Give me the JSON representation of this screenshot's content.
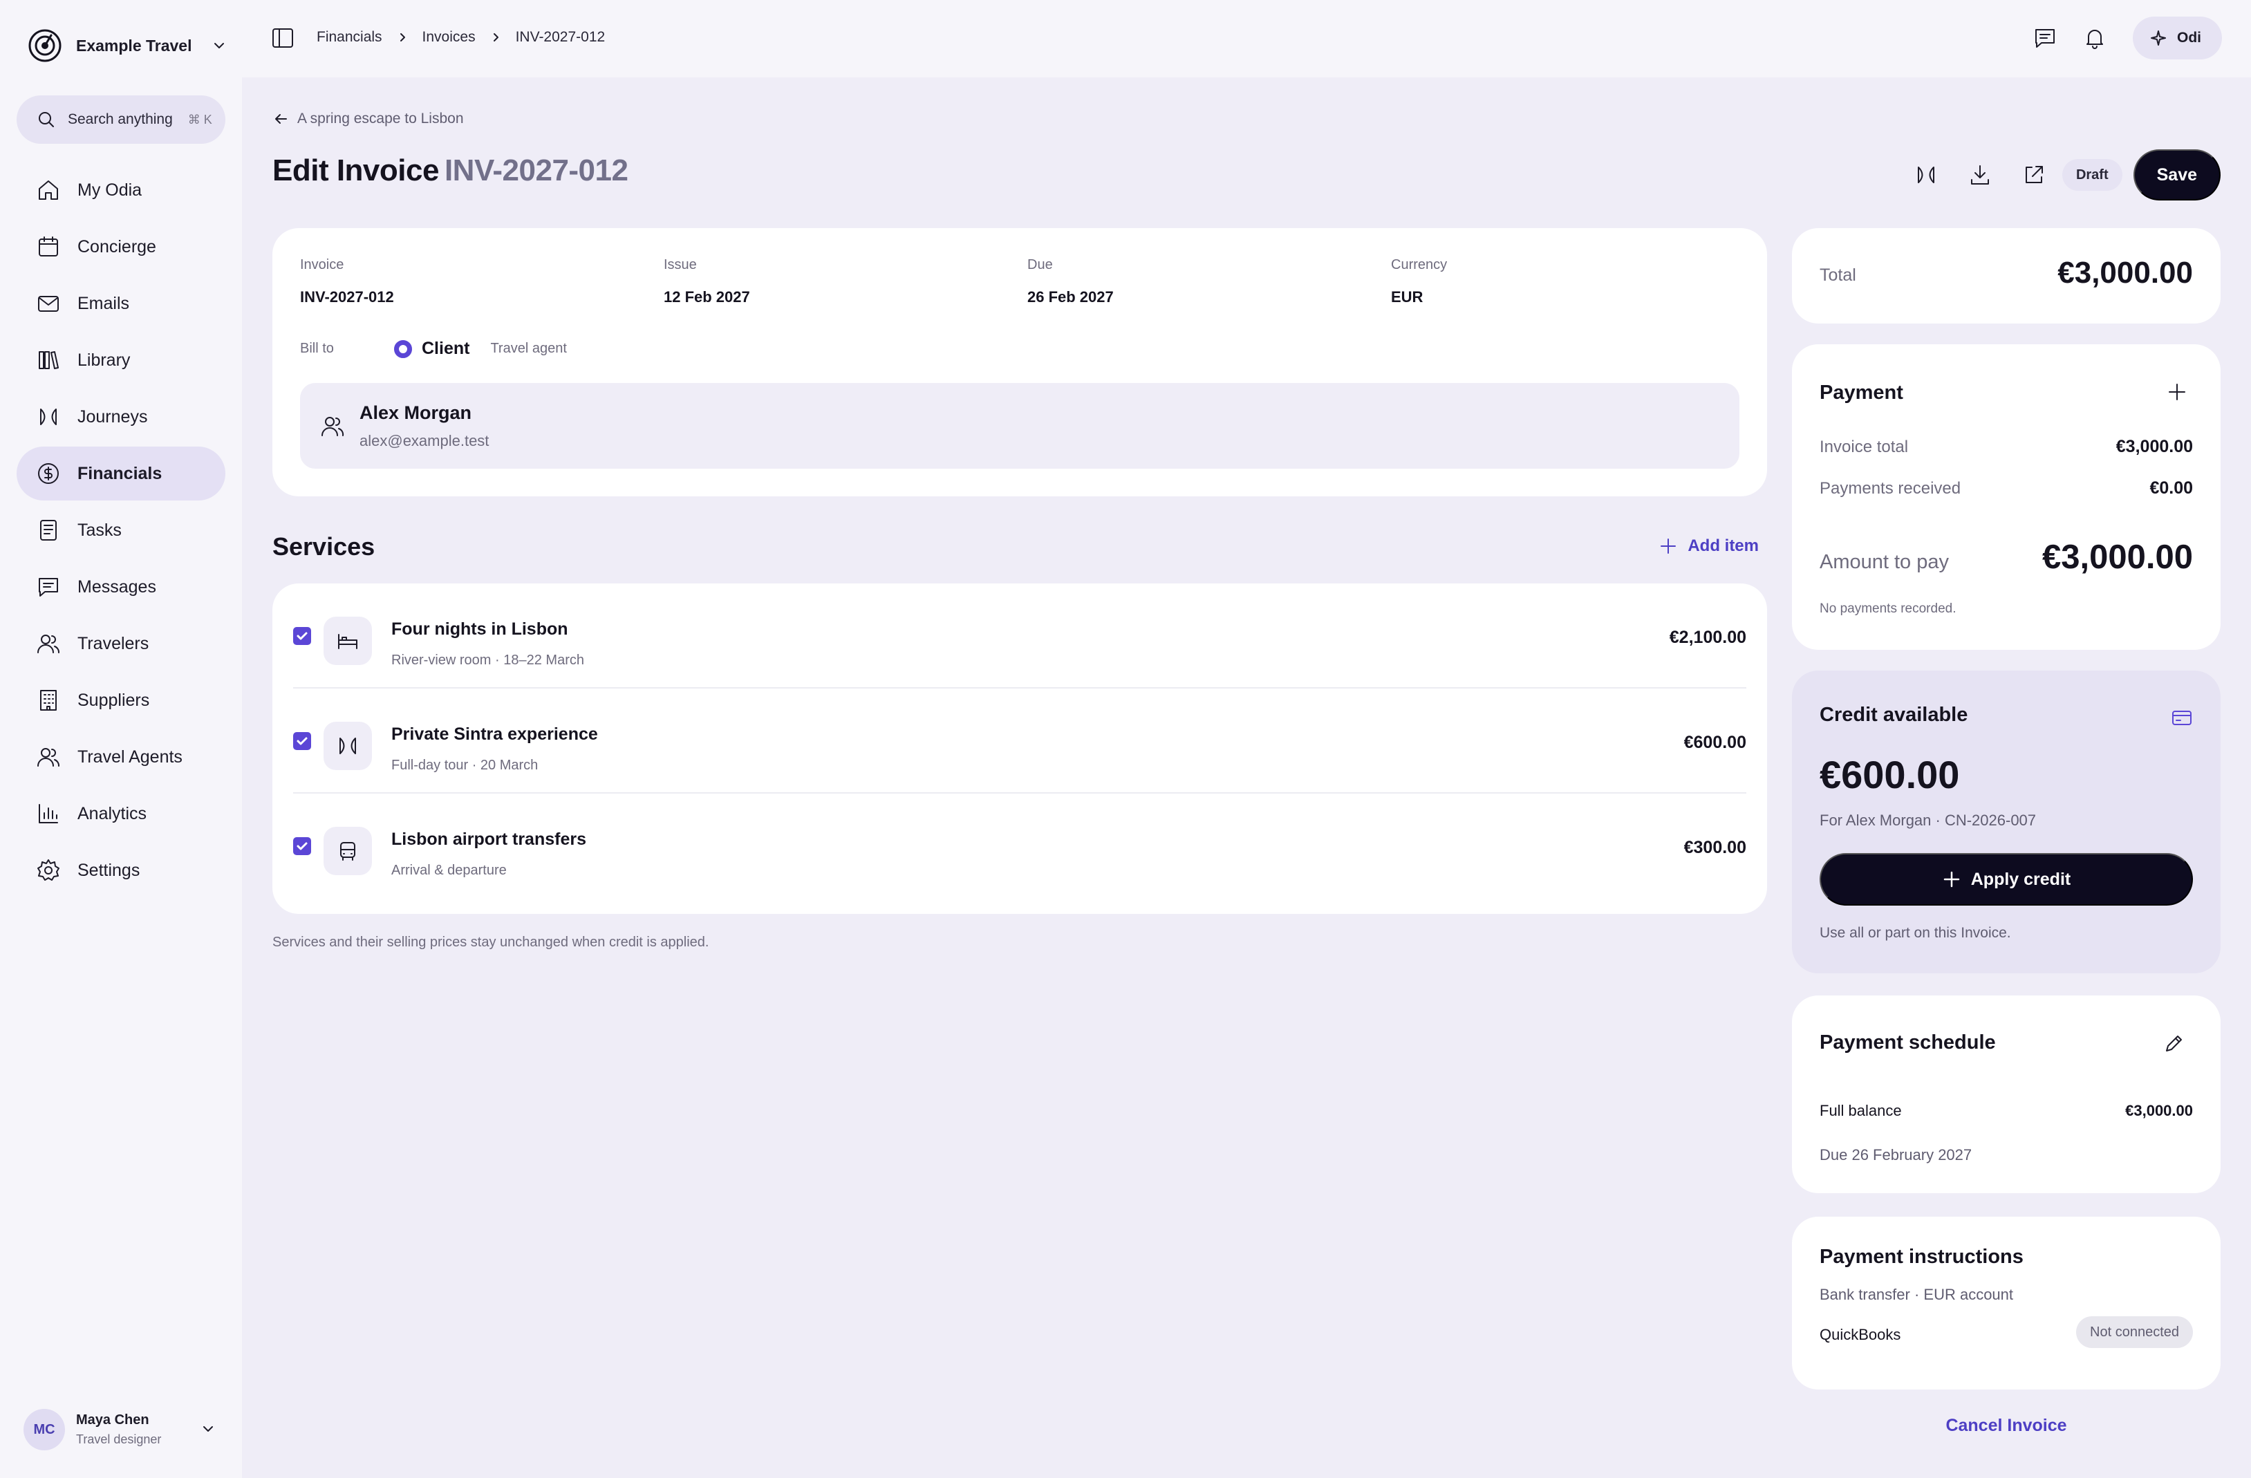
{
  "brand": {
    "name": "Example Travel",
    "logo_icon": "target-logo-icon"
  },
  "search": {
    "label": "Search anything",
    "shortcut": "⌘ K"
  },
  "sidebar": {
    "items": [
      {
        "label": "My Odia",
        "icon": "home-icon",
        "active": false
      },
      {
        "label": "Concierge",
        "icon": "calendar-icon",
        "active": false
      },
      {
        "label": "Emails",
        "icon": "mail-icon",
        "active": false
      },
      {
        "label": "Library",
        "icon": "library-icon",
        "active": false
      },
      {
        "label": "Journeys",
        "icon": "journey-icon",
        "active": false
      },
      {
        "label": "Financials",
        "icon": "dollar-icon",
        "active": true
      },
      {
        "label": "Tasks",
        "icon": "tasks-icon",
        "active": false
      },
      {
        "label": "Messages",
        "icon": "message-icon",
        "active": false
      },
      {
        "label": "Travelers",
        "icon": "users-icon",
        "active": false
      },
      {
        "label": "Suppliers",
        "icon": "building-icon",
        "active": false
      },
      {
        "label": "Travel Agents",
        "icon": "agents-icon",
        "active": false
      },
      {
        "label": "Analytics",
        "icon": "chart-icon",
        "active": false
      },
      {
        "label": "Settings",
        "icon": "gear-icon",
        "active": false
      }
    ]
  },
  "user": {
    "initials": "MC",
    "name": "Maya Chen",
    "role": "Travel designer"
  },
  "topbar": {
    "breadcrumbs": [
      "Financials",
      "Invoices",
      "INV-2027-012"
    ],
    "assistant_label": "Odi"
  },
  "page": {
    "back_label": "A spring escape to Lisbon",
    "title_prefix": "Edit Invoice",
    "title_number": "INV-2027-012",
    "status_chip": "Draft",
    "save_label": "Save"
  },
  "invoice": {
    "fields": [
      {
        "label": "Invoice",
        "value": "INV-2027-012"
      },
      {
        "label": "Issue",
        "value": "12 Feb 2027"
      },
      {
        "label": "Due",
        "value": "26 Feb 2027"
      },
      {
        "label": "Currency",
        "value": "EUR"
      }
    ],
    "bill_to_label": "Bill to",
    "bill_to_selected": "Client",
    "bill_to_other": "Travel agent",
    "client_name": "Alex Morgan",
    "client_email": "alex@example.test"
  },
  "services": {
    "title": "Services",
    "add_label": "Add item",
    "items": [
      {
        "name": "Four nights in Lisbon",
        "detail": "River-view room · 18–22 March",
        "price": "€2,100.00",
        "icon": "bed-icon",
        "checked": true
      },
      {
        "name": "Private Sintra experience",
        "detail": "Full-day tour · 20 March",
        "price": "€600.00",
        "icon": "journey-icon",
        "checked": true
      },
      {
        "name": "Lisbon airport transfers",
        "detail": "Arrival & departure",
        "price": "€300.00",
        "icon": "bus-icon",
        "checked": true
      }
    ],
    "note": "Services and their selling prices stay unchanged when credit is applied."
  },
  "total": {
    "label": "Total",
    "value": "€3,000.00"
  },
  "payment": {
    "title": "Payment",
    "invoice_total_label": "Invoice total",
    "invoice_total": "€3,000.00",
    "received_label": "Payments received",
    "received": "€0.00",
    "amount_label": "Amount to pay",
    "amount": "€3,000.00",
    "note": "No payments recorded."
  },
  "credit": {
    "title": "Credit available",
    "amount": "€600.00",
    "for_text": "For Alex Morgan · CN-2026-007",
    "apply_label": "Apply credit",
    "hint": "Use all or part on this Invoice."
  },
  "schedule": {
    "title": "Payment schedule",
    "row_label": "Full balance",
    "row_value": "€3,000.00",
    "due_text": "Due 26 February 2027"
  },
  "instructions": {
    "title": "Payment instructions",
    "subtitle": "Bank transfer · EUR account",
    "integration_label": "QuickBooks",
    "integration_status": "Not connected"
  },
  "cancel_label": "Cancel Invoice",
  "colors": {
    "accent": "#5b46d6",
    "link": "#4d3fc4",
    "dark": "#0d0b1f",
    "page_bg": "#efedf7"
  }
}
